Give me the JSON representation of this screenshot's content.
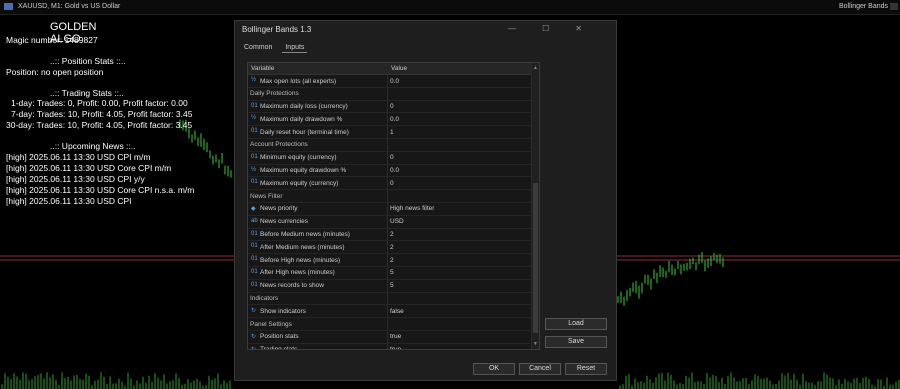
{
  "chart": {
    "symbol": "XAUUSD, M1: Gold vs US Dollar",
    "indicator": "Bollinger Bands"
  },
  "overlay": {
    "title": "GOLDEN ALGO",
    "magic": "Magic number: 1489827",
    "position_header": "..:: Position Stats ::..",
    "position_line": "Position: no open position",
    "trading_header": "..:: Trading Stats ::..",
    "trading_lines": [
      "1-day: Trades: 0, Profit: 0.00, Profit factor: 0.00",
      "7-day: Trades: 10, Profit: 4.05, Profit factor: 3.45",
      "30-day: Trades: 10, Profit: 4.05, Profit factor: 3.45"
    ],
    "news_header": "..:: Upcoming News ::..",
    "news_lines": [
      "[high] 2025.06.11 13:30 USD CPI m/m",
      "[high] 2025.06.11 13:30 USD Core CPI m/m",
      "[high] 2025.06.11 13:30 USD CPI y/y",
      "[high] 2025.06.11 13:30 USD Core CPI n.s.a. m/m",
      "[high] 2025.06.11 13:30 USD CPI"
    ]
  },
  "dialog": {
    "title": "Bollinger Bands 1.3",
    "tabs": [
      "Common",
      "Inputs"
    ],
    "active_tab": "Inputs",
    "col_variable": "Variable",
    "col_value": "Value",
    "rows": [
      {
        "icon": "½",
        "name": "Max open lots (all experts)",
        "value": "0.0"
      },
      {
        "header": true,
        "name": "Daily Protections"
      },
      {
        "icon": "01",
        "name": "Maximum daily loss (currency)",
        "value": "0"
      },
      {
        "icon": "½",
        "name": "Maximum daily drawdown %",
        "value": "0.0"
      },
      {
        "icon": "01",
        "name": "Daily reset hour (terminal time)",
        "value": "1"
      },
      {
        "header": true,
        "name": "Account Protections"
      },
      {
        "icon": "01",
        "name": "Minimum equity (currency)",
        "value": "0"
      },
      {
        "icon": "½",
        "name": "Maximum equity drawdown %",
        "value": "0.0"
      },
      {
        "icon": "01",
        "name": "Maximum equity (currency)",
        "value": "0"
      },
      {
        "header": true,
        "name": "News Filter"
      },
      {
        "icon": "◆",
        "name": "News priority",
        "value": "High news filter"
      },
      {
        "icon": "ab",
        "name": "News currencies",
        "value": "USD"
      },
      {
        "icon": "01",
        "name": "Before Medium news (minutes)",
        "value": "2"
      },
      {
        "icon": "01",
        "name": "After Medium news (minutes)",
        "value": "2"
      },
      {
        "icon": "01",
        "name": "Before High news (minutes)",
        "value": "2"
      },
      {
        "icon": "01",
        "name": "After High news (minutes)",
        "value": "5"
      },
      {
        "icon": "01",
        "name": "News records to show",
        "value": "5"
      },
      {
        "header": true,
        "name": "Indicators"
      },
      {
        "icon": "↻",
        "name": "Show indicators",
        "value": "false"
      },
      {
        "header": true,
        "name": "Panel Settings"
      },
      {
        "icon": "↻",
        "name": "Position stats",
        "value": "true"
      },
      {
        "icon": "↻",
        "name": "Trading stats",
        "value": "true"
      }
    ],
    "buttons": {
      "load": "Load",
      "save": "Save",
      "ok": "OK",
      "cancel": "Cancel",
      "reset": "Reset"
    }
  }
}
